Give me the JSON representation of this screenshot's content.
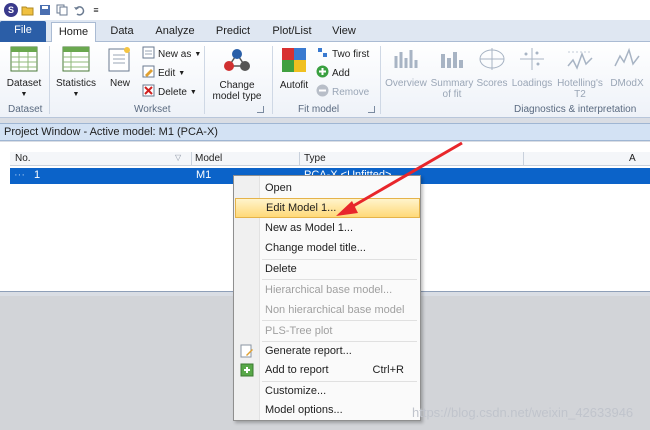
{
  "qat": {
    "logo": "S",
    "more": "≡"
  },
  "tabs": [
    {
      "label": "File"
    },
    {
      "label": "Home"
    },
    {
      "label": "Data"
    },
    {
      "label": "Analyze"
    },
    {
      "label": "Predict"
    },
    {
      "label": "Plot/List"
    },
    {
      "label": "View"
    }
  ],
  "ribbon": {
    "dataset": {
      "label": "Dataset",
      "group": "Dataset"
    },
    "statistics": {
      "label": "Statistics"
    },
    "new": {
      "label": "New"
    },
    "new_as": {
      "label": "New as"
    },
    "edit": {
      "label": "Edit"
    },
    "delete": {
      "label": "Delete"
    },
    "workset_group": "Workset",
    "change_model_type": {
      "line1": "Change",
      "line2": "model type"
    },
    "autofit": {
      "label": "Autofit"
    },
    "two_first": {
      "label": "Two first"
    },
    "add": {
      "label": "Add"
    },
    "remove": {
      "label": "Remove"
    },
    "fit_model_group": "Fit model",
    "overview": {
      "label": "Overview"
    },
    "summary": {
      "line1": "Summary",
      "line2": "of fit"
    },
    "scores": {
      "label": "Scores"
    },
    "loadings": {
      "label": "Loadings"
    },
    "hotellings": {
      "line1": "Hotelling's",
      "line2": "T2"
    },
    "dmodx": {
      "label": "DModX"
    },
    "diag_group": "Diagnostics & interpretation"
  },
  "project_window": {
    "title": "Project Window - Active model: M1 (PCA-X)",
    "columns": {
      "no": "No.",
      "model": "Model",
      "type": "Type",
      "a": "A"
    },
    "rows": [
      {
        "no": "1",
        "model": "M1",
        "type": "PCA-X <Unfitted>"
      }
    ]
  },
  "context_menu": {
    "open": "Open",
    "edit_model": "Edit Model 1...",
    "new_as_model": "New as Model 1...",
    "change_title": "Change model title...",
    "delete": "Delete",
    "hier_base": "Hierarchical base model...",
    "non_hier_base": "Non hierarchical base model",
    "pls_tree": "PLS-Tree plot",
    "generate_report": "Generate report...",
    "add_to_report": "Add to report",
    "add_to_report_shortcut": "Ctrl+R",
    "customize": "Customize...",
    "model_options": "Model options..."
  },
  "watermark": "https://blog.csdn.net/weixin_42633946",
  "colors": {
    "selection": "#0b63c9",
    "highlight": "#ffd978",
    "arrow": "#e8262b",
    "file_tab": "#2b5ea7"
  }
}
